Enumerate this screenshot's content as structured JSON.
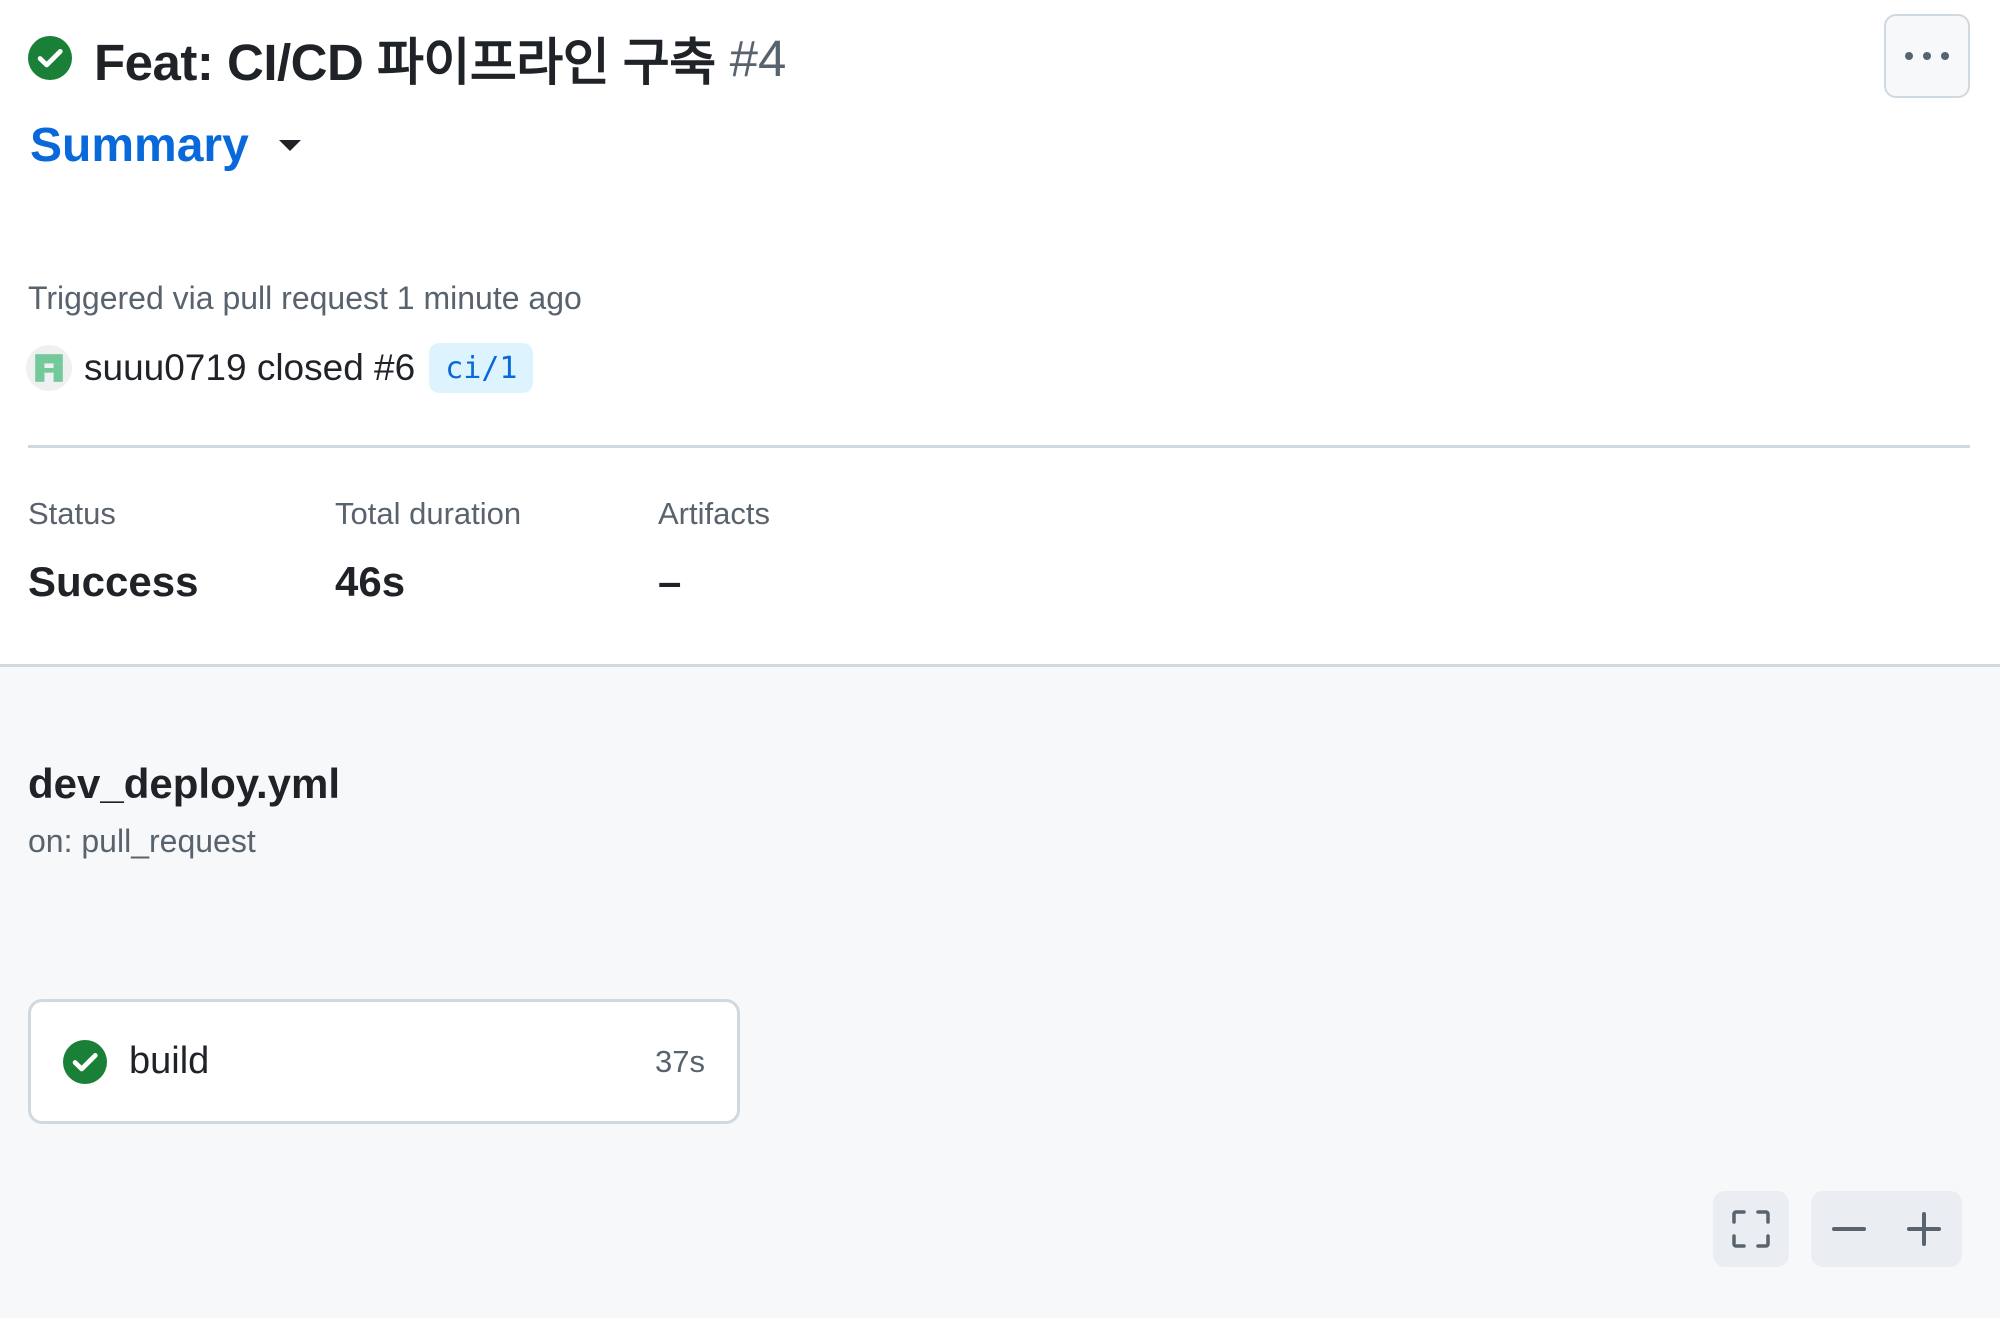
{
  "run": {
    "title": "Feat: CI/CD 파이프라인 구축",
    "number": "#4",
    "status_icon": "check-circle-fill-icon",
    "status_color": "#1a7f37"
  },
  "header": {
    "more_icon": "kebab-horizontal-icon"
  },
  "nav": {
    "summary_label": "Summary",
    "caret_icon": "triangle-down-icon"
  },
  "trigger": {
    "text": "Triggered via pull request 1 minute ago",
    "actor_text": "suuu0719 closed #6",
    "branch": "ci/1",
    "avatar_color": "#72c999"
  },
  "stats": {
    "status_label": "Status",
    "status_value": "Success",
    "duration_label": "Total duration",
    "duration_value": "46s",
    "artifacts_label": "Artifacts",
    "artifacts_value": "–"
  },
  "workflow": {
    "file": "dev_deploy.yml",
    "on": "on: pull_request",
    "jobs": [
      {
        "name": "build",
        "duration": "37s",
        "status": "success"
      }
    ]
  },
  "graph_controls": {
    "fullscreen_icon": "screen-full-icon",
    "zoom_out_icon": "dash-icon",
    "zoom_in_icon": "plus-icon"
  },
  "colors": {
    "link_blue": "#0969da",
    "muted_text": "#59636e",
    "border": "#d1d9e0",
    "canvas_bg": "#f6f8fa",
    "badge_bg": "#ddf4ff"
  }
}
